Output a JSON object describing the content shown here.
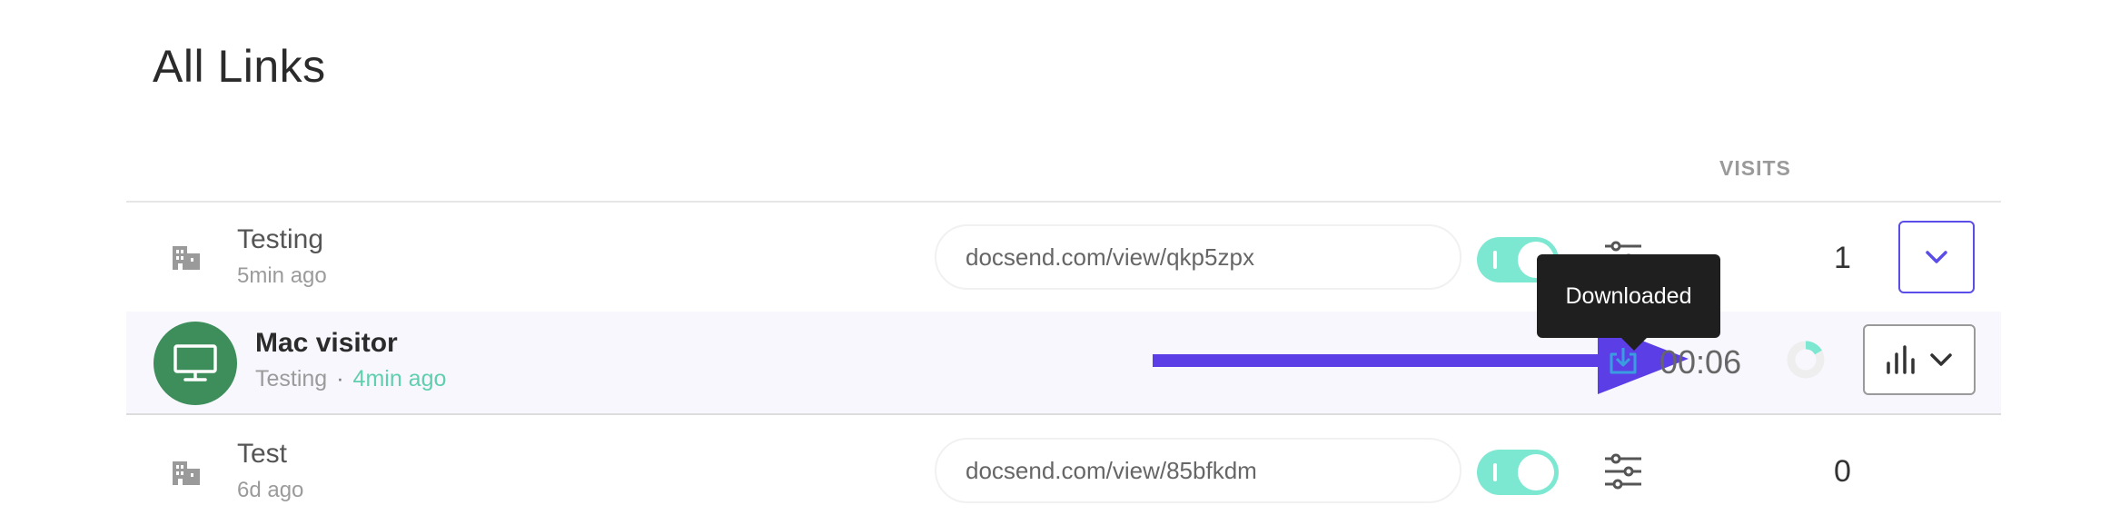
{
  "page": {
    "title": "All Links"
  },
  "table": {
    "visits_header": "VISITS",
    "rows": [
      {
        "name": "Testing",
        "time": "5min ago",
        "url": "docsend.com/view/qkp5zpx",
        "visits": "1",
        "icon": "building-icon"
      },
      {
        "name": "Test",
        "time": "6d ago",
        "url": "docsend.com/view/85bfkdm",
        "visits": "0",
        "icon": "building-icon"
      }
    ]
  },
  "visitor": {
    "name": "Mac visitor",
    "link_name": "Testing",
    "separator": "·",
    "time_ago": "4min ago",
    "duration": "00:06",
    "avatar_icon": "monitor-icon",
    "avatar_color": "#3d8e5a"
  },
  "tooltip": {
    "text": "Downloaded"
  },
  "colors": {
    "accent": "#5b4ee8",
    "toggle_on": "#7de8d2",
    "time_ago": "#5fcfae",
    "download_icon": "#3a9de0",
    "arrow": "#5b3ee6"
  }
}
